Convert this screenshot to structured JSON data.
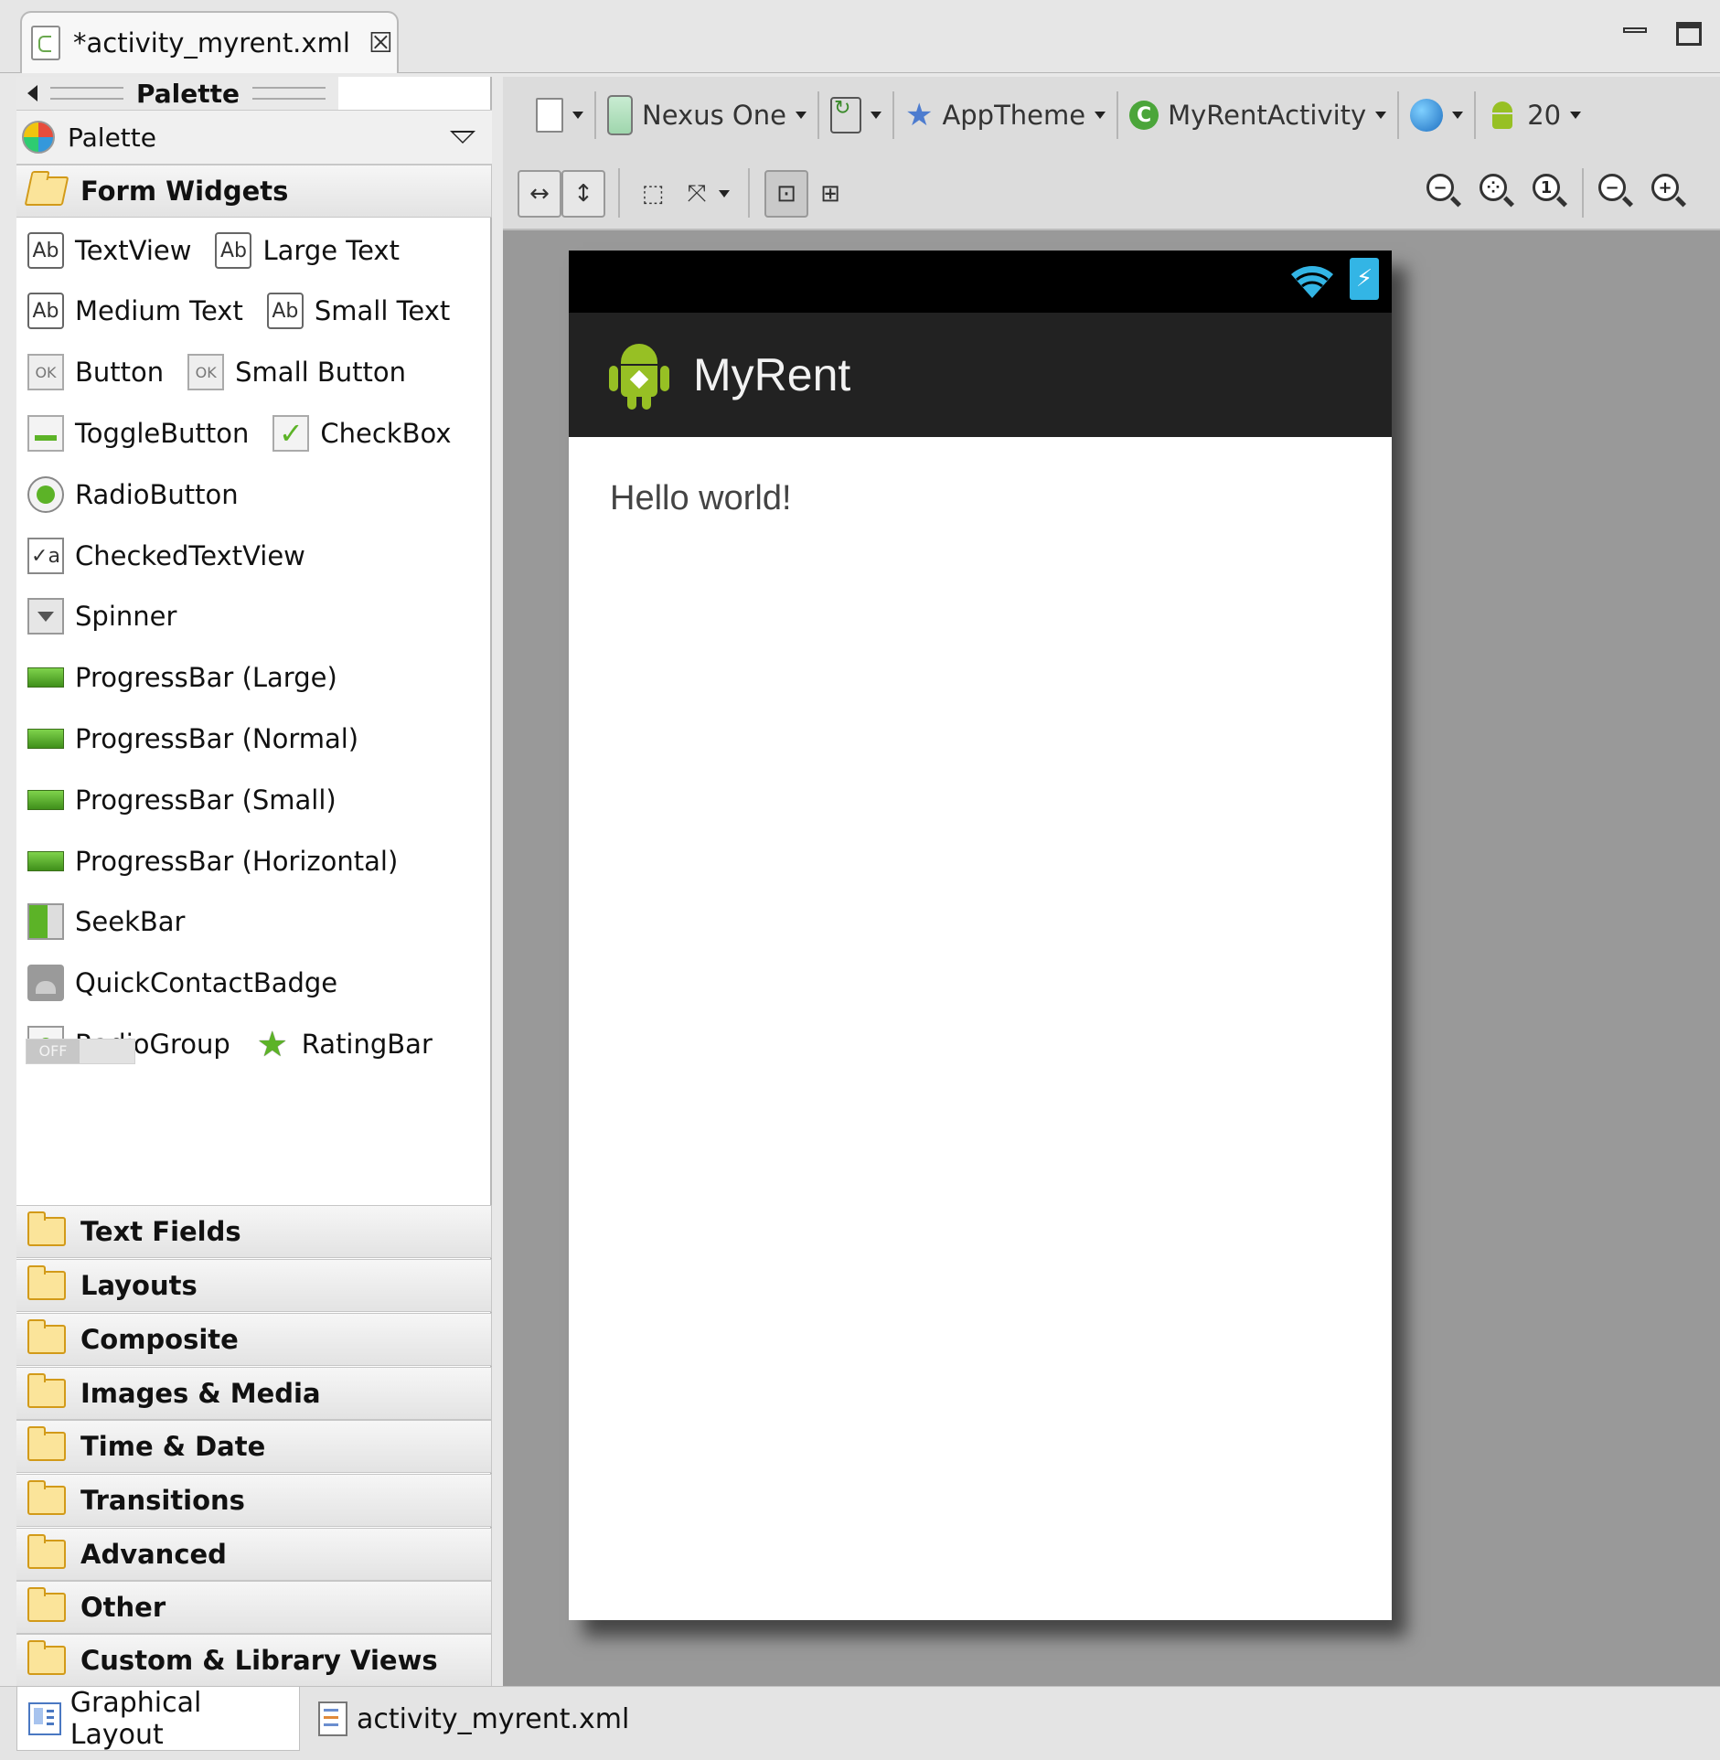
{
  "editor_tab": {
    "title": "*activity_myrent.xml"
  },
  "palette": {
    "panel_title": "Palette",
    "dropdown_label": "Palette",
    "open_category": "Form Widgets",
    "widgets": [
      [
        "TextView",
        "Large Text"
      ],
      [
        "Medium Text",
        "Small Text"
      ],
      [
        "Button",
        "Small Button"
      ],
      [
        "ToggleButton",
        "CheckBox"
      ],
      [
        "RadioButton"
      ],
      [
        "CheckedTextView"
      ],
      [
        "Spinner"
      ],
      [
        "ProgressBar (Large)"
      ],
      [
        "ProgressBar (Normal)"
      ],
      [
        "ProgressBar (Small)"
      ],
      [
        "ProgressBar (Horizontal)"
      ],
      [
        "SeekBar"
      ],
      [
        "QuickContactBadge"
      ],
      [
        "RadioGroup",
        "RatingBar"
      ]
    ],
    "switch_label": "OFF",
    "categories": [
      "Text Fields",
      "Layouts",
      "Composite",
      "Images & Media",
      "Time & Date",
      "Transitions",
      "Advanced",
      "Other",
      "Custom & Library Views"
    ]
  },
  "toolbar": {
    "device": "Nexus One",
    "theme": "AppTheme",
    "activity": "MyRentActivity",
    "api_level": "20"
  },
  "preview": {
    "app_title": "MyRent",
    "content_text": "Hello world!"
  },
  "bottom_tabs": {
    "graphical": "Graphical Layout",
    "xml": "activity_myrent.xml"
  }
}
